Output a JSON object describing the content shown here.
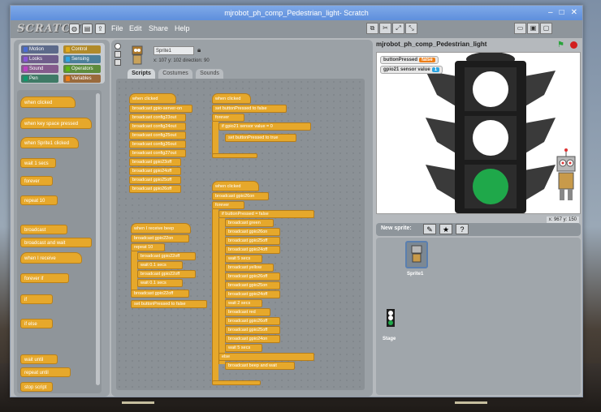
{
  "window": {
    "title": "mjrobot_ph_comp_Pedestrian_light- Scratch"
  },
  "menu": {
    "logo": "SCRATCH",
    "items": [
      "File",
      "Edit",
      "Share",
      "Help"
    ]
  },
  "categories": [
    {
      "label": "Motion",
      "color": "#4a6cd4"
    },
    {
      "label": "Control",
      "color": "#e1a91a"
    },
    {
      "label": "Looks",
      "color": "#8a55d7"
    },
    {
      "label": "Sensing",
      "color": "#2ca5e2"
    },
    {
      "label": "Sound",
      "color": "#bb42c3"
    },
    {
      "label": "Operators",
      "color": "#5cb712"
    },
    {
      "label": "Pen",
      "color": "#0e9a6c"
    },
    {
      "label": "Variables",
      "color": "#ee7d16"
    }
  ],
  "palette_blocks": [
    "when clicked",
    "when key space pressed",
    "when Sprite1 clicked",
    "wait 1 secs",
    "forever",
    "repeat 10",
    "broadcast",
    "broadcast and wait",
    "when I receive",
    "forever if",
    "if",
    "if else",
    "wait until",
    "repeat until",
    "stop script"
  ],
  "sprite": {
    "name": "Sprite1",
    "coords": "x: 107  y: 102  direction: 90"
  },
  "tabs": [
    "Scripts",
    "Costumes",
    "Sounds"
  ],
  "scripts": {
    "s1": [
      "when clicked",
      "broadcast gpio-server-on",
      "broadcast config23out",
      "broadcast config24out",
      "broadcast config25out",
      "broadcast config26out",
      "broadcast config27out",
      "broadcast gpio23off",
      "broadcast gpio24off",
      "broadcast gpio25off",
      "broadcast gpio26off"
    ],
    "s2": [
      "when clicked",
      "set buttonPressed to false",
      "forever",
      "if gpio21 sensor value = 0",
      "set buttonPressed to true"
    ],
    "s3": [
      "when I receive beep",
      "broadcast gpio22on",
      "repeat 10",
      "broadcast gpio22off",
      "wait 0.1 secs",
      "broadcast gpio22off",
      "wait 0.1 secs",
      "broadcast gpio22off",
      "set buttonPressed to false"
    ],
    "s4": [
      "when clicked",
      "broadcast gpio26on",
      "forever",
      "if buttonPressed = false",
      "broadcast green",
      "broadcast gpio26on",
      "broadcast gpio25off",
      "broadcast gpio24off",
      "wait 5 secs",
      "broadcast yellow",
      "broadcast gpio26off",
      "broadcast gpio25on",
      "broadcast gpio24off",
      "wait 2 secs",
      "broadcast red",
      "broadcast gpio26off",
      "broadcast gpio25off",
      "broadcast gpio24on",
      "wait 5 secs",
      "else",
      "broadcast beep and wait"
    ]
  },
  "stage": {
    "title": "mjrobot_ph_comp_Pedestrian_light",
    "watchers": [
      {
        "label": "buttonPressed",
        "value": "false",
        "color": "#ee7d16"
      },
      {
        "label": "gpio21 sensor value",
        "value": "1",
        "color": "#2ca5e2"
      }
    ],
    "mouse": "x: 967  y: 150",
    "light_colors": [
      "#ffffff",
      "#ffffff",
      "#1fa84a"
    ]
  },
  "sprites_pane": {
    "new_sprite_label": "New sprite:",
    "items": [
      "Sprite1",
      "Stage"
    ]
  }
}
